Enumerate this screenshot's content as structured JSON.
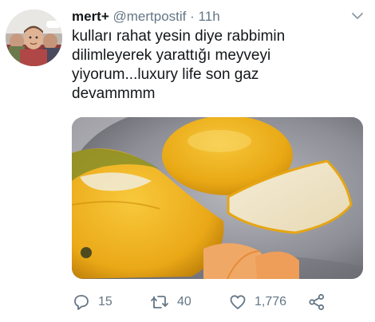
{
  "tweet": {
    "display_name": "mert+",
    "handle": "@mertpostif",
    "separator": "·",
    "time": "11h",
    "text_lines": [
      "kulları rahat yesin diye rabbimin",
      "dilimleyerek yarattığı meyveyi",
      "yiyorum...luxury life son gaz",
      "devammmm"
    ],
    "actions": {
      "reply_count": "15",
      "retweet_count": "40",
      "like_count": "1,776"
    }
  },
  "icons": {
    "caret": "chevron-down-icon",
    "reply": "reply-icon",
    "retweet": "retweet-icon",
    "like": "heart-icon",
    "share": "share-icon"
  },
  "colors": {
    "text": "#14171a",
    "secondary": "#657786"
  }
}
